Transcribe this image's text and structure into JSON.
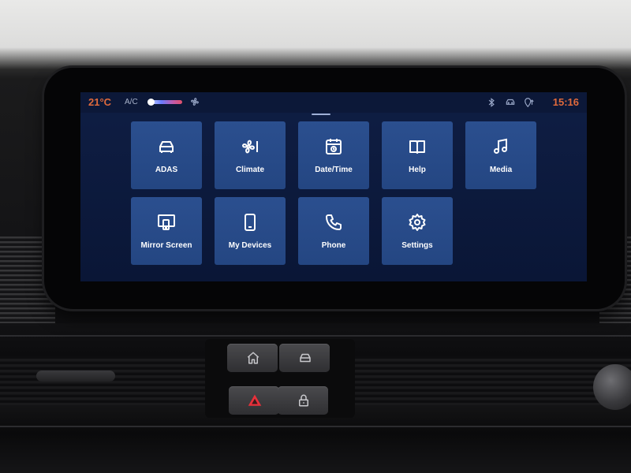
{
  "status_bar": {
    "temperature": "21°C",
    "ac_label": "A/C",
    "clock": "15:16",
    "icons": [
      "fan-icon",
      "bluetooth-icon",
      "car-connect-icon",
      "location-icon"
    ]
  },
  "tiles": [
    {
      "label": "ADAS",
      "icon": "car-icon"
    },
    {
      "label": "Climate",
      "icon": "fan-icon"
    },
    {
      "label": "Date/Time",
      "icon": "calendar-clock-icon"
    },
    {
      "label": "Help",
      "icon": "book-icon"
    },
    {
      "label": "Media",
      "icon": "music-note-icon"
    },
    {
      "label": "Mirror Screen",
      "icon": "mirror-screen-icon"
    },
    {
      "label": "My Devices",
      "icon": "phone-device-icon"
    },
    {
      "label": "Phone",
      "icon": "phone-handset-icon"
    },
    {
      "label": "Settings",
      "icon": "gear-icon"
    }
  ],
  "colors": {
    "accent_orange": "#e06a3c",
    "tile_blue": "#2b4f8f",
    "screen_bg": "#0f1e44"
  },
  "controls": {
    "icons": [
      "home-icon",
      "car-icon",
      "hazard-icon",
      "lock-icon"
    ]
  }
}
